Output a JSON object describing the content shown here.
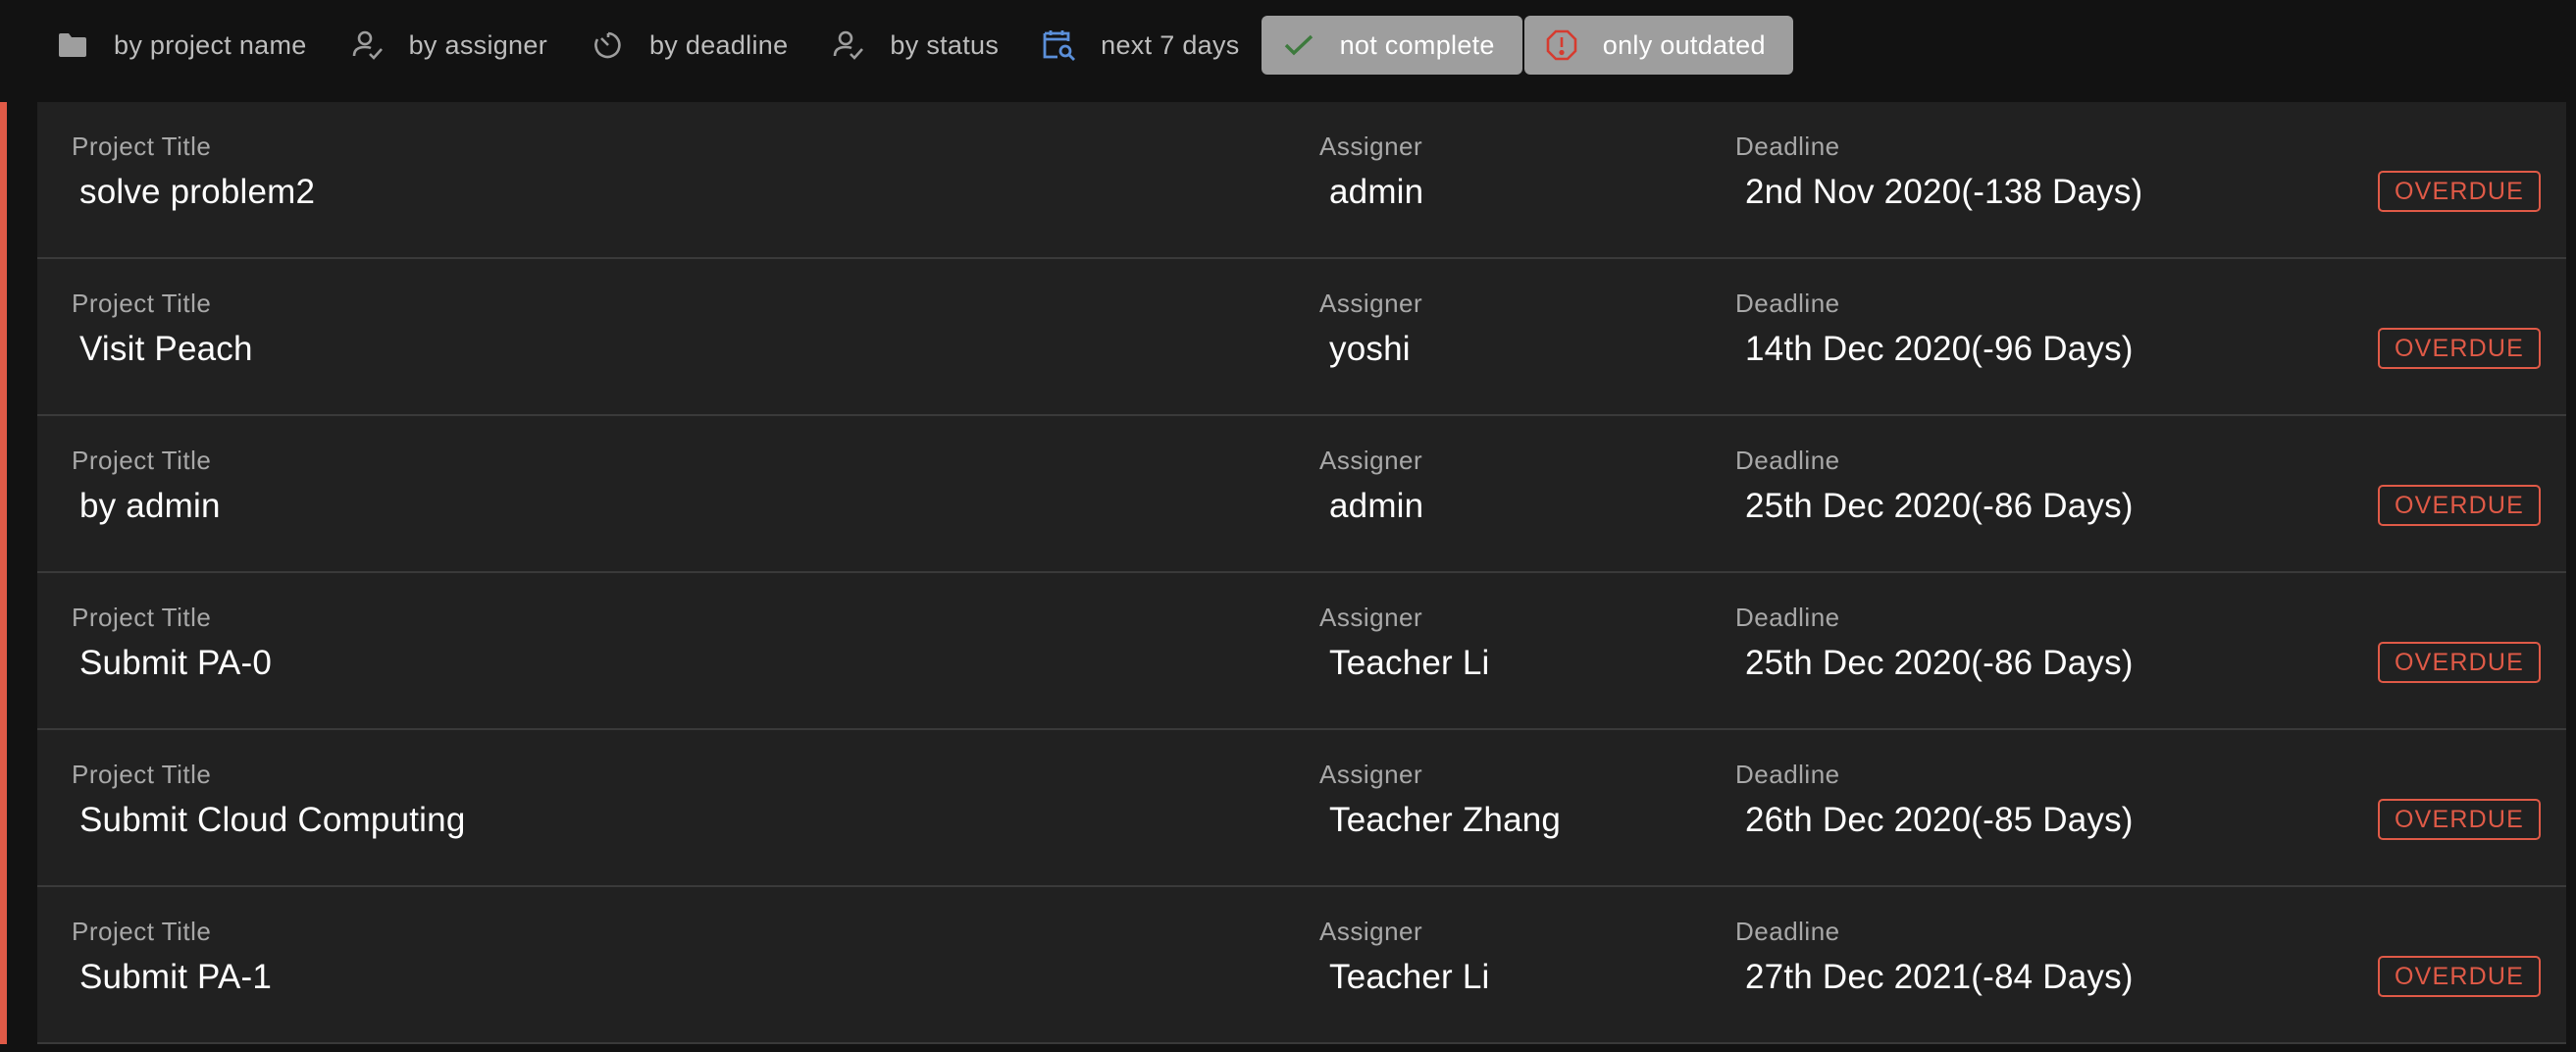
{
  "filters": [
    {
      "label": "by project name",
      "icon": "folder-icon",
      "active": false
    },
    {
      "label": "by assigner",
      "icon": "person-check-icon",
      "active": false
    },
    {
      "label": "by deadline",
      "icon": "timer-icon",
      "active": false
    },
    {
      "label": "by status",
      "icon": "person-check-icon",
      "active": false
    },
    {
      "label": "next 7 days",
      "icon": "calendar-search-icon",
      "active": false
    },
    {
      "label": "not complete",
      "icon": "check-icon",
      "active": true
    },
    {
      "label": "only outdated",
      "icon": "alert-circle-icon",
      "active": true
    }
  ],
  "labels": {
    "title": "Project Title",
    "assigner": "Assigner",
    "deadline": "Deadline"
  },
  "projects": [
    {
      "title": "solve problem2",
      "assigner": "admin",
      "deadline": "2nd Nov 2020(-138 Days)",
      "status": "OVERDUE"
    },
    {
      "title": "Visit Peach",
      "assigner": "yoshi",
      "deadline": "14th Dec 2020(-96 Days)",
      "status": "OVERDUE"
    },
    {
      "title": "by admin",
      "assigner": "admin",
      "deadline": "25th Dec 2020(-86 Days)",
      "status": "OVERDUE"
    },
    {
      "title": "Submit PA-0",
      "assigner": "Teacher Li",
      "deadline": "25th Dec 2020(-86 Days)",
      "status": "OVERDUE"
    },
    {
      "title": "Submit Cloud Computing",
      "assigner": "Teacher Zhang",
      "deadline": "26th Dec 2020(-85 Days)",
      "status": "OVERDUE"
    },
    {
      "title": "Submit PA-1",
      "assigner": "Teacher Li",
      "deadline": "27th Dec 2021(-84 Days)",
      "status": "OVERDUE"
    }
  ],
  "colors": {
    "background": "#121212",
    "card": "#212121",
    "overdue": "#e05a47",
    "active_filter": "#9e9e9e",
    "next7_icon": "#5b8fd9",
    "check_icon": "#3d7a3d"
  }
}
